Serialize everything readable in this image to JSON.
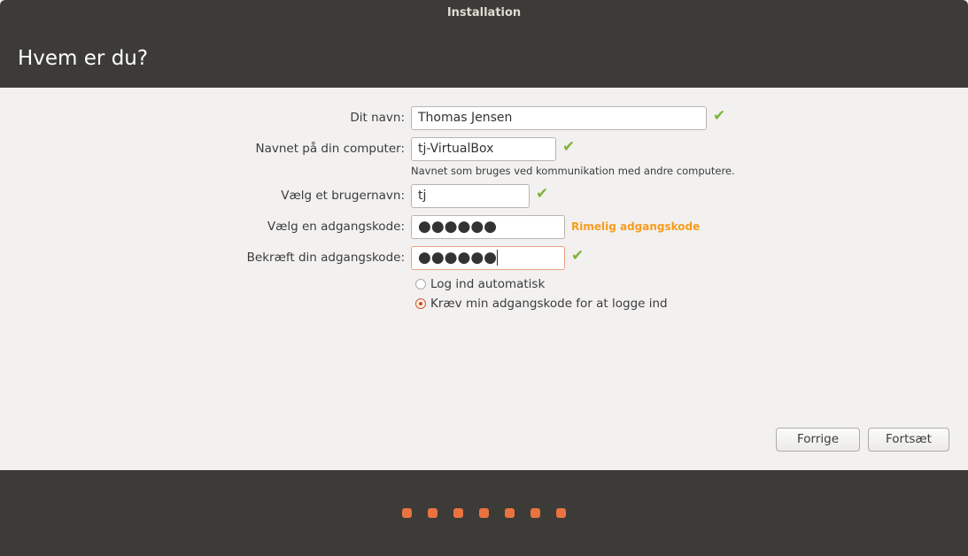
{
  "window": {
    "title": "Installation"
  },
  "header": {
    "title": "Hvem er du?"
  },
  "form": {
    "name": {
      "label": "Dit navn:",
      "value": "Thomas Jensen"
    },
    "computer": {
      "label": "Navnet på din computer:",
      "value": "tj-VirtualBox",
      "hint": "Navnet som bruges ved kommunikation med andre computere."
    },
    "username": {
      "label": "Vælg et brugernavn:",
      "value": "tj"
    },
    "password": {
      "label": "Vælg en adgangskode:",
      "value": "●●●●●●",
      "strength": "Rimelig adgangskode"
    },
    "confirm": {
      "label": "Bekræft din adgangskode:",
      "value": "●●●●●●"
    },
    "login_options": [
      {
        "label": "Log ind automatisk",
        "selected": false
      },
      {
        "label": "Kræv min adgangskode for at logge ind",
        "selected": true
      }
    ]
  },
  "buttons": {
    "back": "Forrige",
    "continue": "Fortsæt"
  },
  "progress": {
    "steps": 7,
    "color": "#e9733f"
  },
  "check_symbol": "✔"
}
